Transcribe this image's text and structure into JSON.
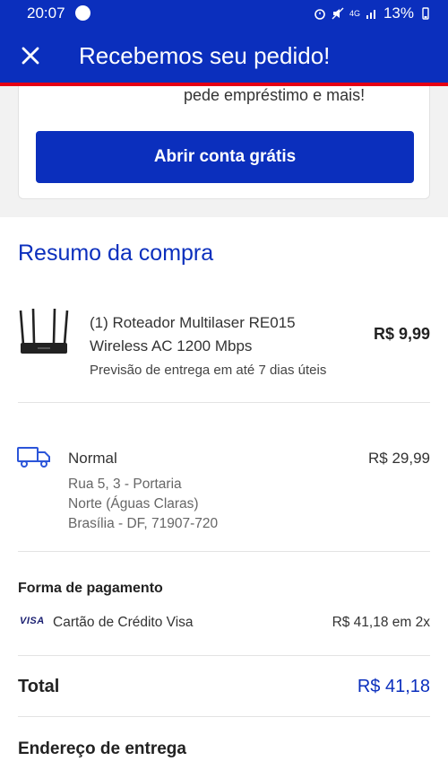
{
  "status_bar": {
    "time": "20:07",
    "signal_text": "4G",
    "battery": "13%"
  },
  "app_bar": {
    "close_icon": "close-icon",
    "title": "Recebemos seu pedido!"
  },
  "promo_card": {
    "text": "pede empréstimo e mais!",
    "button_label": "Abrir conta grátis"
  },
  "summary": {
    "title": "Resumo da compra",
    "product": {
      "name_line1": "(1) Roteador Multilaser RE015",
      "name_line2": "Wireless AC 1200 Mbps",
      "price": "R$ 9,99",
      "eta": "Previsão de entrega em até 7 dias úteis",
      "image_icon": "router-image"
    },
    "shipping": {
      "icon": "truck-icon",
      "method": "Normal",
      "price": "R$ 29,99",
      "address_line1": "Rua 5, 3 - Portaria",
      "address_line2": "Norte (Águas Claras)",
      "address_line3": "Brasília - DF, 71907-720"
    },
    "payment": {
      "title": "Forma de pagamento",
      "card_brand": "VISA",
      "method": "Cartão de Crédito Visa",
      "installments": "R$ 41,18 em 2x"
    },
    "total": {
      "label": "Total",
      "value": "R$ 41,18"
    },
    "delivery_address_title": "Endereço de entrega"
  },
  "colors": {
    "primary": "#0b2fbd",
    "accent_red": "#e60014"
  }
}
